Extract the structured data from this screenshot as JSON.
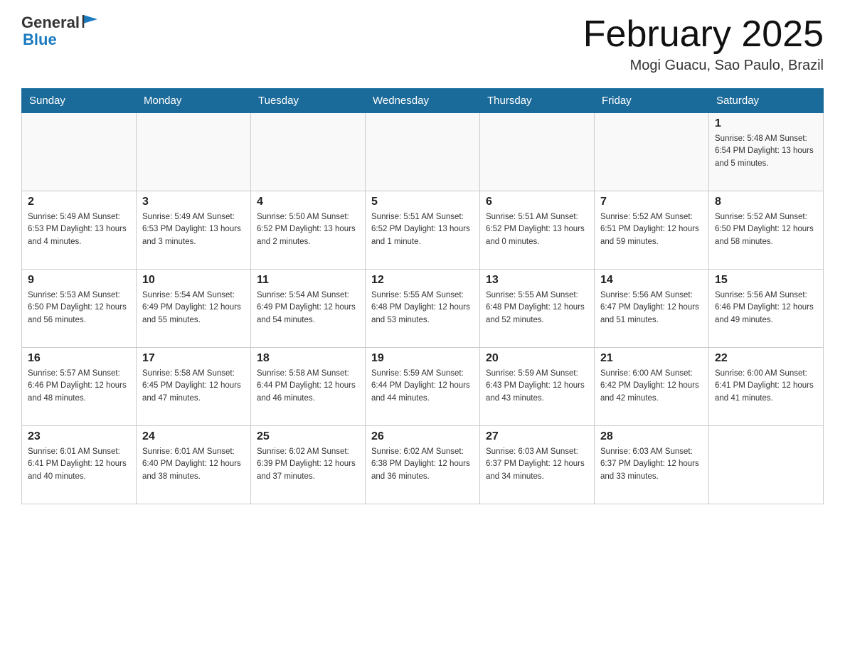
{
  "logo": {
    "text_general": "General",
    "text_blue": "Blue"
  },
  "title": {
    "month": "February 2025",
    "location": "Mogi Guacu, Sao Paulo, Brazil"
  },
  "weekdays": [
    "Sunday",
    "Monday",
    "Tuesday",
    "Wednesday",
    "Thursday",
    "Friday",
    "Saturday"
  ],
  "weeks": [
    [
      {
        "day": "",
        "info": ""
      },
      {
        "day": "",
        "info": ""
      },
      {
        "day": "",
        "info": ""
      },
      {
        "day": "",
        "info": ""
      },
      {
        "day": "",
        "info": ""
      },
      {
        "day": "",
        "info": ""
      },
      {
        "day": "1",
        "info": "Sunrise: 5:48 AM\nSunset: 6:54 PM\nDaylight: 13 hours and 5 minutes."
      }
    ],
    [
      {
        "day": "2",
        "info": "Sunrise: 5:49 AM\nSunset: 6:53 PM\nDaylight: 13 hours and 4 minutes."
      },
      {
        "day": "3",
        "info": "Sunrise: 5:49 AM\nSunset: 6:53 PM\nDaylight: 13 hours and 3 minutes."
      },
      {
        "day": "4",
        "info": "Sunrise: 5:50 AM\nSunset: 6:52 PM\nDaylight: 13 hours and 2 minutes."
      },
      {
        "day": "5",
        "info": "Sunrise: 5:51 AM\nSunset: 6:52 PM\nDaylight: 13 hours and 1 minute."
      },
      {
        "day": "6",
        "info": "Sunrise: 5:51 AM\nSunset: 6:52 PM\nDaylight: 13 hours and 0 minutes."
      },
      {
        "day": "7",
        "info": "Sunrise: 5:52 AM\nSunset: 6:51 PM\nDaylight: 12 hours and 59 minutes."
      },
      {
        "day": "8",
        "info": "Sunrise: 5:52 AM\nSunset: 6:50 PM\nDaylight: 12 hours and 58 minutes."
      }
    ],
    [
      {
        "day": "9",
        "info": "Sunrise: 5:53 AM\nSunset: 6:50 PM\nDaylight: 12 hours and 56 minutes."
      },
      {
        "day": "10",
        "info": "Sunrise: 5:54 AM\nSunset: 6:49 PM\nDaylight: 12 hours and 55 minutes."
      },
      {
        "day": "11",
        "info": "Sunrise: 5:54 AM\nSunset: 6:49 PM\nDaylight: 12 hours and 54 minutes."
      },
      {
        "day": "12",
        "info": "Sunrise: 5:55 AM\nSunset: 6:48 PM\nDaylight: 12 hours and 53 minutes."
      },
      {
        "day": "13",
        "info": "Sunrise: 5:55 AM\nSunset: 6:48 PM\nDaylight: 12 hours and 52 minutes."
      },
      {
        "day": "14",
        "info": "Sunrise: 5:56 AM\nSunset: 6:47 PM\nDaylight: 12 hours and 51 minutes."
      },
      {
        "day": "15",
        "info": "Sunrise: 5:56 AM\nSunset: 6:46 PM\nDaylight: 12 hours and 49 minutes."
      }
    ],
    [
      {
        "day": "16",
        "info": "Sunrise: 5:57 AM\nSunset: 6:46 PM\nDaylight: 12 hours and 48 minutes."
      },
      {
        "day": "17",
        "info": "Sunrise: 5:58 AM\nSunset: 6:45 PM\nDaylight: 12 hours and 47 minutes."
      },
      {
        "day": "18",
        "info": "Sunrise: 5:58 AM\nSunset: 6:44 PM\nDaylight: 12 hours and 46 minutes."
      },
      {
        "day": "19",
        "info": "Sunrise: 5:59 AM\nSunset: 6:44 PM\nDaylight: 12 hours and 44 minutes."
      },
      {
        "day": "20",
        "info": "Sunrise: 5:59 AM\nSunset: 6:43 PM\nDaylight: 12 hours and 43 minutes."
      },
      {
        "day": "21",
        "info": "Sunrise: 6:00 AM\nSunset: 6:42 PM\nDaylight: 12 hours and 42 minutes."
      },
      {
        "day": "22",
        "info": "Sunrise: 6:00 AM\nSunset: 6:41 PM\nDaylight: 12 hours and 41 minutes."
      }
    ],
    [
      {
        "day": "23",
        "info": "Sunrise: 6:01 AM\nSunset: 6:41 PM\nDaylight: 12 hours and 40 minutes."
      },
      {
        "day": "24",
        "info": "Sunrise: 6:01 AM\nSunset: 6:40 PM\nDaylight: 12 hours and 38 minutes."
      },
      {
        "day": "25",
        "info": "Sunrise: 6:02 AM\nSunset: 6:39 PM\nDaylight: 12 hours and 37 minutes."
      },
      {
        "day": "26",
        "info": "Sunrise: 6:02 AM\nSunset: 6:38 PM\nDaylight: 12 hours and 36 minutes."
      },
      {
        "day": "27",
        "info": "Sunrise: 6:03 AM\nSunset: 6:37 PM\nDaylight: 12 hours and 34 minutes."
      },
      {
        "day": "28",
        "info": "Sunrise: 6:03 AM\nSunset: 6:37 PM\nDaylight: 12 hours and 33 minutes."
      },
      {
        "day": "",
        "info": ""
      }
    ]
  ]
}
